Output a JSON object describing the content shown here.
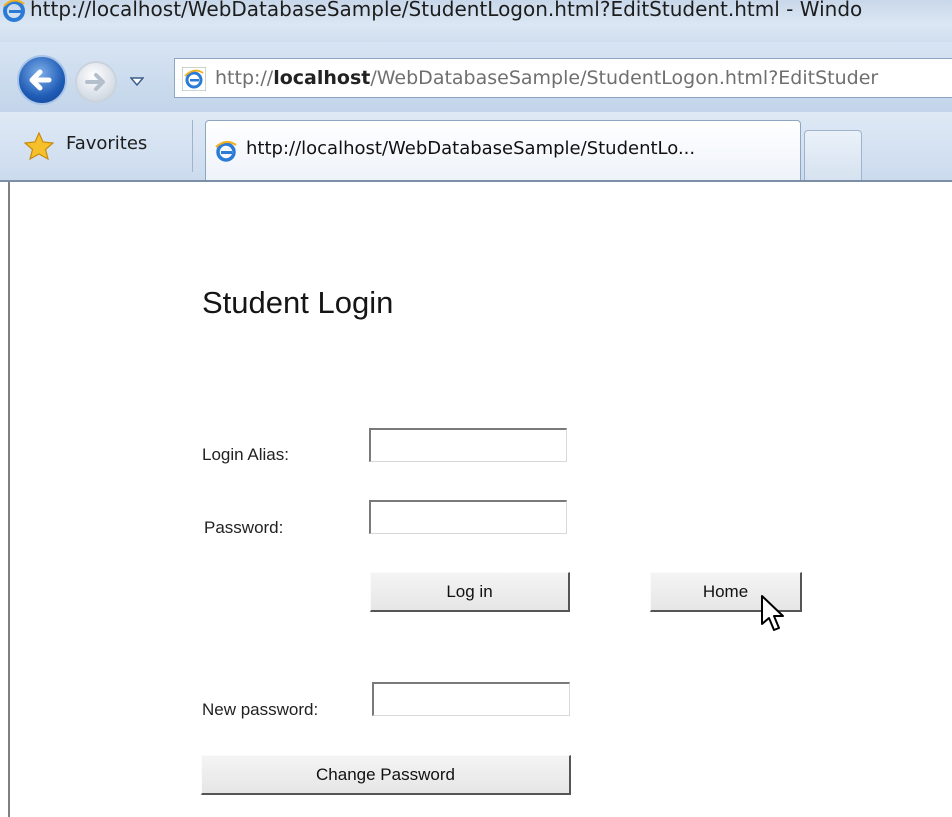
{
  "window": {
    "title": "http://localhost/WebDatabaseSample/StudentLogon.html?EditStudent.html - Windo"
  },
  "navigation": {
    "address_prefix": "http://",
    "address_host": "localhost",
    "address_path": "/WebDatabaseSample/StudentLogon.html?EditStuder"
  },
  "tabs": {
    "favorites_label": "Favorites",
    "active_tab_title": "http://localhost/WebDatabaseSample/StudentLo..."
  },
  "page": {
    "heading": "Student Login",
    "login_alias_label": "Login Alias:",
    "login_alias_value": "",
    "password_label": "Password:",
    "password_value": "",
    "login_button": "Log in",
    "home_button": "Home",
    "new_password_label": "New password:",
    "new_password_value": "",
    "change_password_button": "Change Password"
  },
  "colors": {
    "chrome_blue": "#c8d7e9",
    "accent_error": "#c00000"
  },
  "icons": {
    "browser": "ie-logo-icon",
    "back": "back-arrow-icon",
    "forward": "forward-arrow-icon",
    "favorites": "favorites-star-icon",
    "cursor": "mouse-pointer-icon"
  }
}
